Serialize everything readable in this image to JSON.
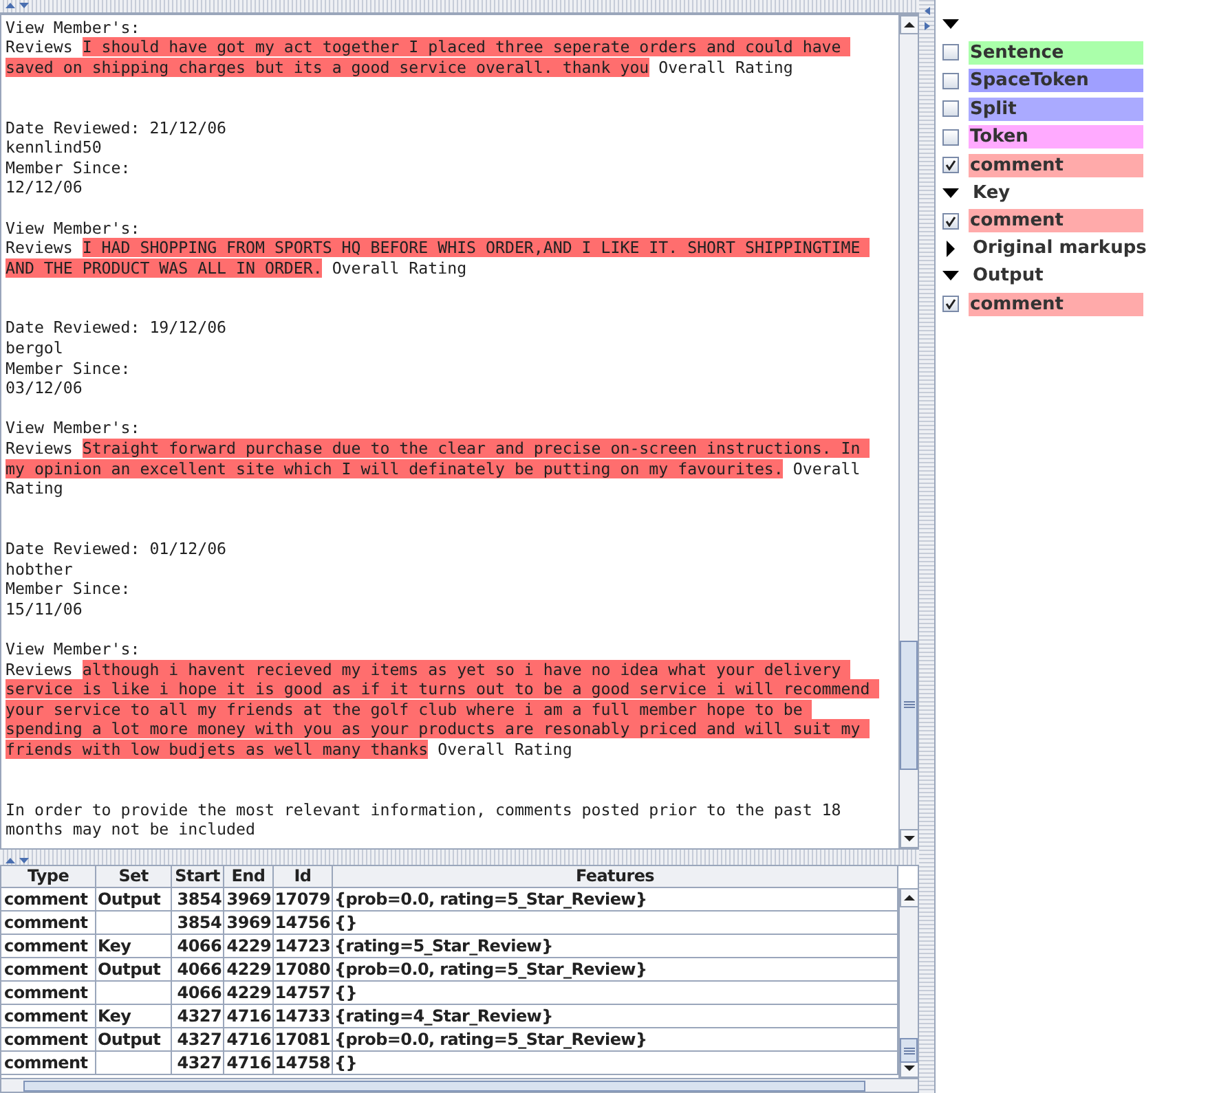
{
  "document": {
    "lines": [
      {
        "kind": "text",
        "segments": [
          {
            "text": "View Member's:",
            "annotated": false
          }
        ]
      },
      {
        "kind": "text",
        "segments": [
          {
            "text": "Reviews ",
            "annotated": false
          },
          {
            "text": "I should have got my act together I placed three seperate orders and could have ",
            "annotated": true
          }
        ]
      },
      {
        "kind": "text",
        "segments": [
          {
            "text": "saved on shipping charges but its a good service overall. thank you",
            "annotated": true
          },
          {
            "text": " Overall Rating",
            "annotated": false
          }
        ]
      },
      {
        "kind": "blank"
      },
      {
        "kind": "blank"
      },
      {
        "kind": "text",
        "segments": [
          {
            "text": "Date Reviewed: 21/12/06",
            "annotated": false
          }
        ]
      },
      {
        "kind": "text",
        "segments": [
          {
            "text": "kennlind50",
            "annotated": false
          }
        ]
      },
      {
        "kind": "text",
        "segments": [
          {
            "text": "Member Since:",
            "annotated": false
          }
        ]
      },
      {
        "kind": "text",
        "segments": [
          {
            "text": "12/12/06",
            "annotated": false
          }
        ]
      },
      {
        "kind": "blank"
      },
      {
        "kind": "text",
        "segments": [
          {
            "text": "View Member's:",
            "annotated": false
          }
        ]
      },
      {
        "kind": "text",
        "segments": [
          {
            "text": "Reviews ",
            "annotated": false
          },
          {
            "text": "I HAD SHOPPING FROM SPORTS HQ BEFORE WHIS ORDER,AND I LIKE IT. SHORT SHIPPINGTIME ",
            "annotated": true
          }
        ]
      },
      {
        "kind": "text",
        "segments": [
          {
            "text": "AND THE PRODUCT WAS ALL IN ORDER.",
            "annotated": true
          },
          {
            "text": " Overall Rating",
            "annotated": false
          }
        ]
      },
      {
        "kind": "blank"
      },
      {
        "kind": "blank"
      },
      {
        "kind": "text",
        "segments": [
          {
            "text": "Date Reviewed: 19/12/06",
            "annotated": false
          }
        ]
      },
      {
        "kind": "text",
        "segments": [
          {
            "text": "bergol",
            "annotated": false
          }
        ]
      },
      {
        "kind": "text",
        "segments": [
          {
            "text": "Member Since:",
            "annotated": false
          }
        ]
      },
      {
        "kind": "text",
        "segments": [
          {
            "text": "03/12/06",
            "annotated": false
          }
        ]
      },
      {
        "kind": "blank"
      },
      {
        "kind": "text",
        "segments": [
          {
            "text": "View Member's:",
            "annotated": false
          }
        ]
      },
      {
        "kind": "text",
        "segments": [
          {
            "text": "Reviews ",
            "annotated": false
          },
          {
            "text": "Straight forward purchase due to the clear and precise on-screen instructions. In ",
            "annotated": true
          }
        ]
      },
      {
        "kind": "text",
        "segments": [
          {
            "text": "my opinion an excellent site which I will definately be putting on my favourites.",
            "annotated": true
          },
          {
            "text": " Overall",
            "annotated": false
          }
        ]
      },
      {
        "kind": "text",
        "segments": [
          {
            "text": "Rating",
            "annotated": false
          }
        ]
      },
      {
        "kind": "blank"
      },
      {
        "kind": "blank"
      },
      {
        "kind": "text",
        "segments": [
          {
            "text": "Date Reviewed: 01/12/06",
            "annotated": false
          }
        ]
      },
      {
        "kind": "text",
        "segments": [
          {
            "text": "hobther",
            "annotated": false
          }
        ]
      },
      {
        "kind": "text",
        "segments": [
          {
            "text": "Member Since:",
            "annotated": false
          }
        ]
      },
      {
        "kind": "text",
        "segments": [
          {
            "text": "15/11/06",
            "annotated": false
          }
        ]
      },
      {
        "kind": "blank"
      },
      {
        "kind": "text",
        "segments": [
          {
            "text": "View Member's:",
            "annotated": false
          }
        ]
      },
      {
        "kind": "text",
        "segments": [
          {
            "text": "Reviews ",
            "annotated": false
          },
          {
            "text": "although i havent recieved my items as yet so i have no idea what your delivery ",
            "annotated": true
          }
        ]
      },
      {
        "kind": "text",
        "segments": [
          {
            "text": "service is like i hope it is good as if it turns out to be a good service i will recommend ",
            "annotated": true
          }
        ]
      },
      {
        "kind": "text",
        "segments": [
          {
            "text": "your service to all my friends at the golf club where i am a full member hope to be ",
            "annotated": true
          }
        ]
      },
      {
        "kind": "text",
        "segments": [
          {
            "text": "spending a lot more money with you as your products are resonably priced and will suit my ",
            "annotated": true
          }
        ]
      },
      {
        "kind": "text",
        "segments": [
          {
            "text": "friends with low budjets as well many thanks",
            "annotated": true
          },
          {
            "text": " Overall Rating",
            "annotated": false
          }
        ]
      },
      {
        "kind": "blank"
      },
      {
        "kind": "blank"
      },
      {
        "kind": "text",
        "segments": [
          {
            "text": "In order to provide the most relevant information, comments posted prior to the past 18",
            "annotated": false
          }
        ]
      },
      {
        "kind": "text",
        "segments": [
          {
            "text": "months may not be included",
            "annotated": false
          }
        ]
      }
    ]
  },
  "annotation_sets": [
    {
      "expanded": true,
      "types": [
        {
          "name": "Sentence",
          "color": "#aaffaa",
          "checked": false
        },
        {
          "name": "SpaceToken",
          "color": "#9f9fff",
          "checked": false
        },
        {
          "name": "Split",
          "color": "#aaaaff",
          "checked": false
        },
        {
          "name": "Token",
          "color": "#ffaaff",
          "checked": false
        },
        {
          "name": "comment",
          "color": "#ffaaaa",
          "checked": true
        }
      ]
    },
    {
      "name": "Key",
      "expanded": true,
      "types": [
        {
          "name": "comment",
          "color": "#ffaaaa",
          "checked": true
        }
      ]
    },
    {
      "name": "Original markups",
      "expanded": false
    },
    {
      "name": "Output",
      "expanded": true,
      "types": [
        {
          "name": "comment",
          "color": "#ffaaaa",
          "checked": true
        }
      ]
    }
  ],
  "table": {
    "columns": [
      "Type",
      "Set",
      "Start",
      "End",
      "Id",
      "Features"
    ],
    "rows": [
      [
        "comment",
        "Output",
        "3854",
        "3969",
        "17079",
        "{prob=0.0, rating=5_Star_Review}"
      ],
      [
        "comment",
        "",
        "3854",
        "3969",
        "14756",
        "{}"
      ],
      [
        "comment",
        "Key",
        "4066",
        "4229",
        "14723",
        "{rating=5_Star_Review}"
      ],
      [
        "comment",
        "Output",
        "4066",
        "4229",
        "17080",
        "{prob=0.0, rating=5_Star_Review}"
      ],
      [
        "comment",
        "",
        "4066",
        "4229",
        "14757",
        "{}"
      ],
      [
        "comment",
        "Key",
        "4327",
        "4716",
        "14733",
        "{rating=4_Star_Review}"
      ],
      [
        "comment",
        "Output",
        "4327",
        "4716",
        "17081",
        "{prob=0.0, rating=5_Star_Review}"
      ],
      [
        "comment",
        "",
        "4327",
        "4716",
        "14758",
        "{}"
      ]
    ]
  }
}
